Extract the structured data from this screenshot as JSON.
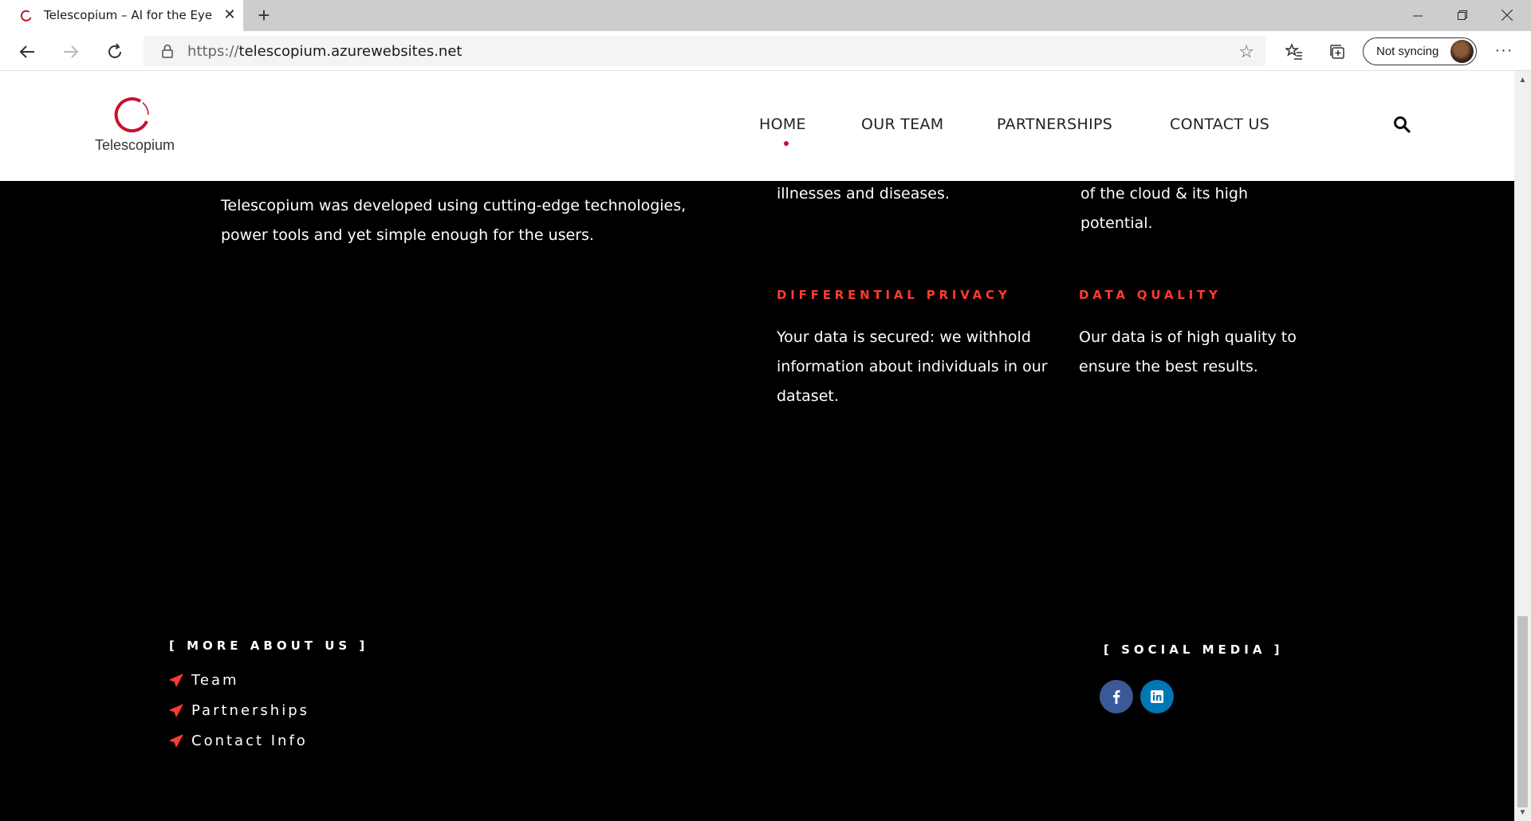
{
  "browser": {
    "tab_title": "Telescopium – AI for the Eye",
    "url_scheme": "https://",
    "url_host": "telescopium.azurewebsites.net",
    "sync_label": "Not syncing"
  },
  "header": {
    "logo_text": "Telescopium",
    "menu": [
      "HOME",
      "OUR TEAM",
      "PARTNERSHIPS",
      "CONTACT US"
    ],
    "active_menu": "HOME"
  },
  "content": {
    "intro_text_line1": "Telescopium was developed using cutting-edge technologies,",
    "intro_text_line2": "power tools and yet simple enough for the users.",
    "top_mid_text": "illnesses and diseases.",
    "top_right_line1": "of the cloud & its high",
    "top_right_line2": "potential.",
    "features": [
      {
        "title": "DIFFERENTIAL PRIVACY",
        "line1": "Your data is secured: we withhold",
        "line2": "information about individuals in our",
        "line3": "dataset."
      },
      {
        "title": "DATA QUALITY",
        "line1": "Our data is of high quality to",
        "line2": "ensure the best results."
      }
    ]
  },
  "footer": {
    "more_heading": "[ MORE ABOUT US ]",
    "links": [
      "Team",
      "Partnerships",
      "Contact Info"
    ],
    "social_heading": "[ SOCIAL MEDIA ]",
    "social": [
      {
        "icon": "facebook-icon",
        "color": "#3b5998"
      },
      {
        "icon": "linkedin-icon",
        "color": "#0077b5"
      }
    ]
  },
  "colors": {
    "accent_red": "#ff3b2f",
    "brand_red": "#c8102e"
  }
}
